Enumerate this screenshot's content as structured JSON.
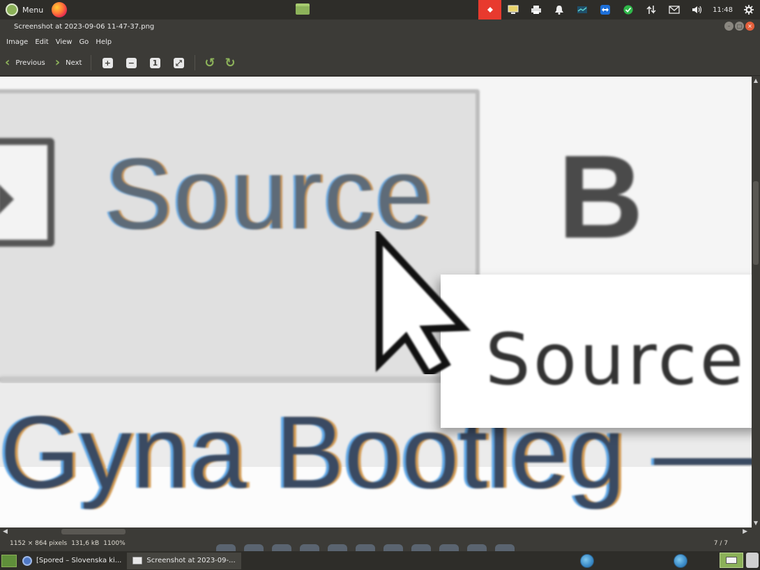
{
  "top_panel": {
    "menu_label": "Menu",
    "clock": "11:48"
  },
  "window": {
    "title": "Screenshot at 2023-09-06 11-47-37.png"
  },
  "menubar": {
    "items": [
      "Image",
      "Edit",
      "View",
      "Go",
      "Help"
    ]
  },
  "toolbar": {
    "previous_label": "Previous",
    "next_label": "Next"
  },
  "image_content": {
    "tab_text": "Source",
    "bold_text": "B",
    "tooltip_text": "Source",
    "heading_text": "Gyna Bootleg —"
  },
  "statusbar": {
    "dimensions": "1152 × 864 pixels",
    "file_size": "131,6 kB",
    "zoom": "1100%",
    "position": "7 / 7"
  },
  "taskbar": {
    "items": [
      {
        "label": "[Spored – Slovenska ki..."
      },
      {
        "label": "Screenshot at 2023-09-..."
      }
    ]
  }
}
